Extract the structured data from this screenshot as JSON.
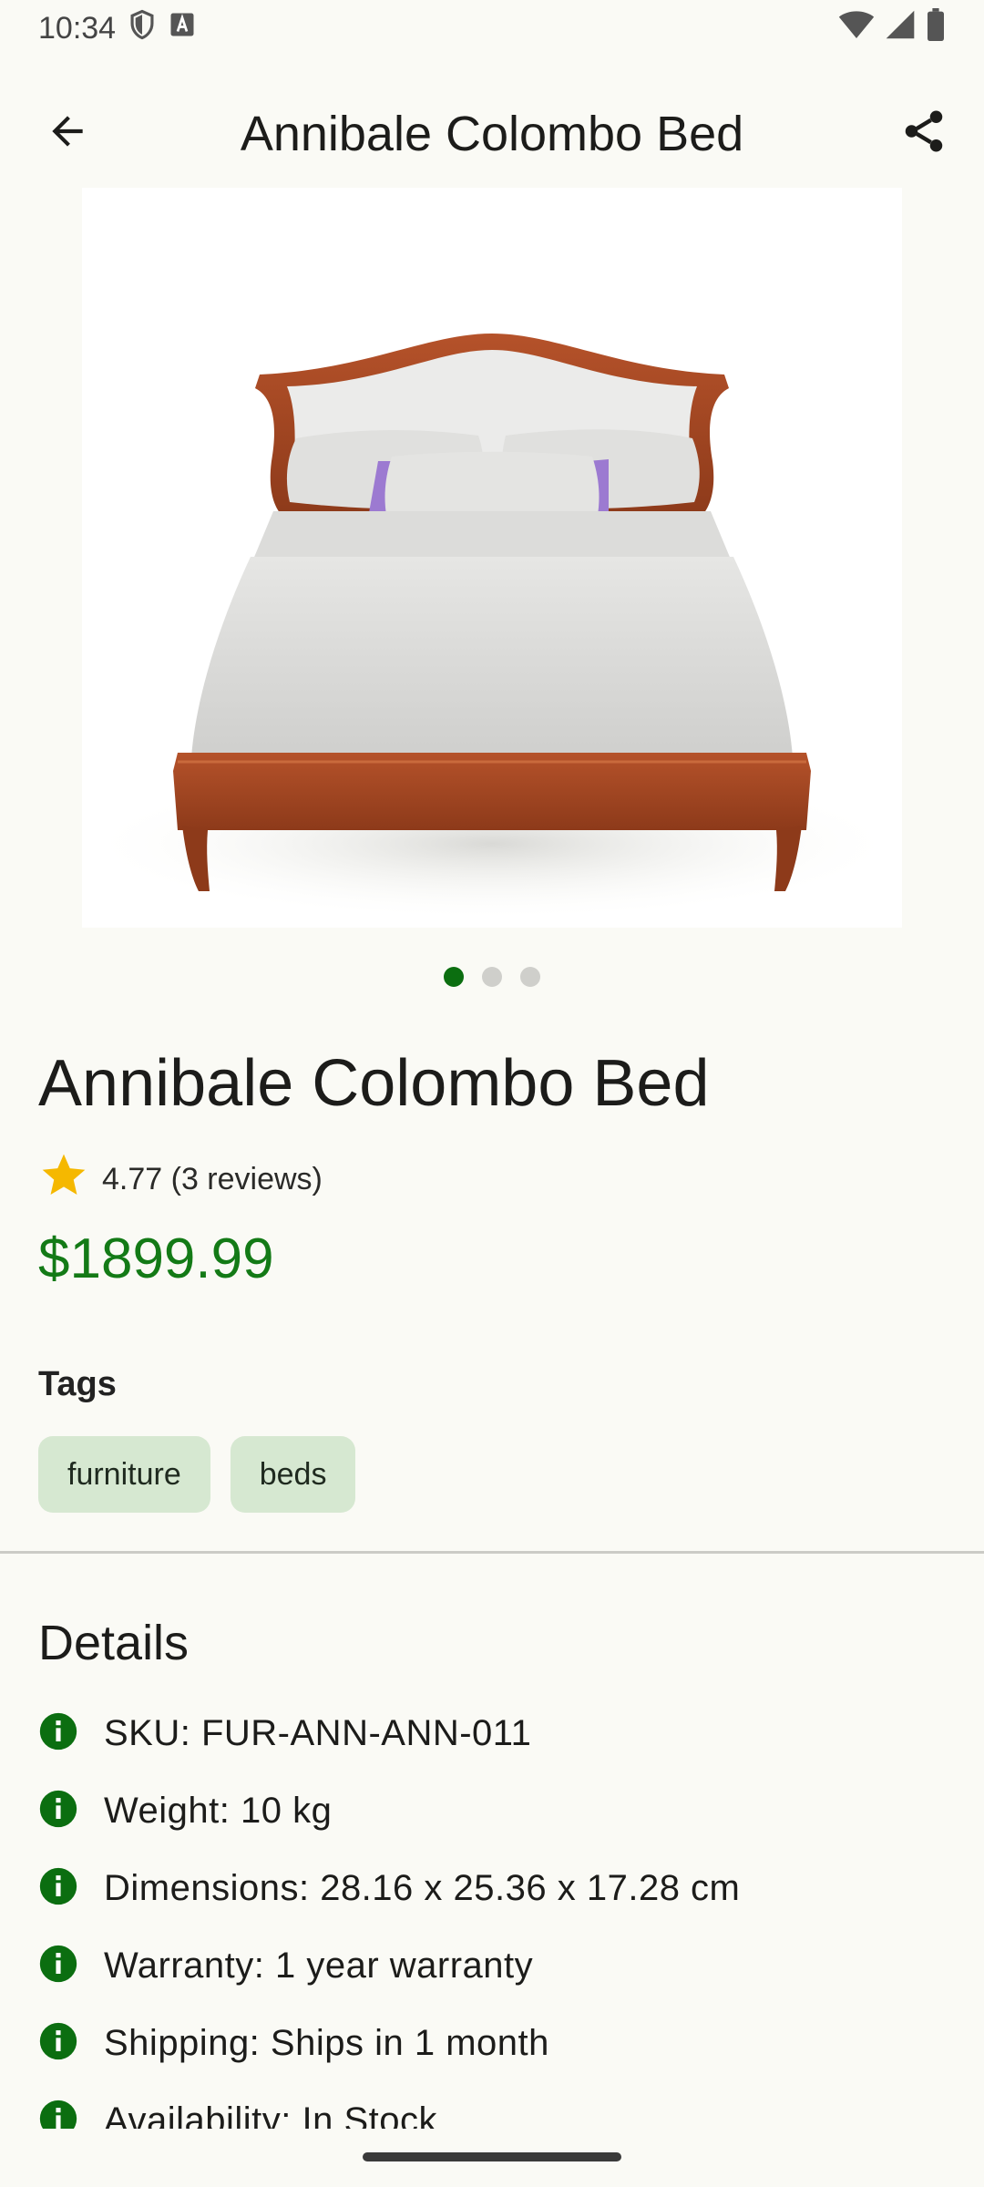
{
  "status": {
    "time": "10:34"
  },
  "app_bar": {
    "title": "Annibale Colombo Bed"
  },
  "gallery": {
    "image_count": 3,
    "current_index": 1
  },
  "product": {
    "title": "Annibale Colombo Bed",
    "rating_text": "4.77 (3 reviews)",
    "price": "$1899.99"
  },
  "tags": {
    "heading": "Tags",
    "items": [
      "furniture",
      "beds"
    ]
  },
  "details": {
    "heading": "Details",
    "items": [
      "SKU: FUR-ANN-ANN-011",
      "Weight: 10 kg",
      "Dimensions: 28.16 x 25.36 x 17.28 cm",
      "Warranty: 1 year warranty",
      "Shipping: Ships in 1 month",
      "Availability: In Stock"
    ]
  },
  "colors": {
    "accent": "#137a16",
    "chip_bg": "#d6e8d1",
    "background": "#fafaf5",
    "star": "#f5b800"
  }
}
